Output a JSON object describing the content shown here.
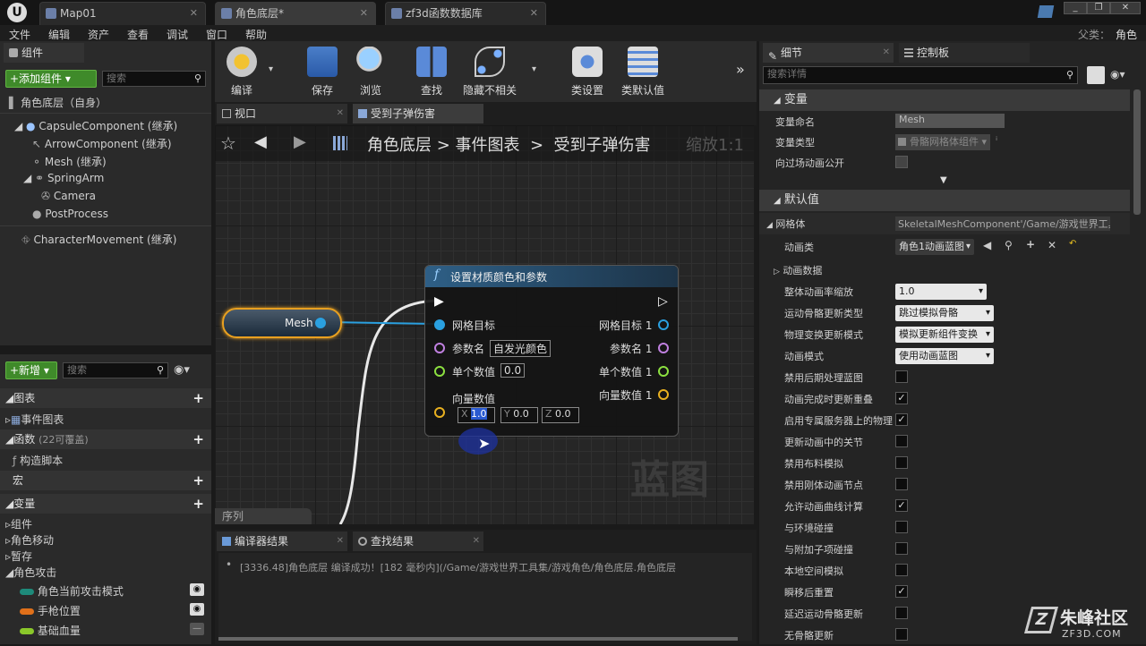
{
  "titlebar": {
    "tabs": [
      "Map01",
      "角色底层*",
      "zf3d函数数据库"
    ],
    "parent_label": "父类：",
    "parent_value": "角色"
  },
  "menu": [
    "文件",
    "编辑",
    "资产",
    "查看",
    "调试",
    "窗口",
    "帮助"
  ],
  "components": {
    "tab": "组件",
    "add_button": "+添加组件",
    "search_placeholder": "搜索",
    "root": "角色底层（自身）",
    "items": [
      "CapsuleComponent (继承)",
      "ArrowComponent (继承)",
      "Mesh (继承)",
      "SpringArm",
      "Camera",
      "PostProcess",
      "CharacterMovement (继承)"
    ]
  },
  "mybp": {
    "add_button": "+新增",
    "search_placeholder": "搜索",
    "sections": {
      "graphs": "图表",
      "event_graph": "事件图表",
      "functions": "函数",
      "functions_note": "(22可覆盖)",
      "construction": "构造脚本",
      "macros": "宏",
      "variables": "变量"
    },
    "var_groups": [
      "组件",
      "角色移动",
      "暂存",
      "角色攻击"
    ],
    "vars": [
      "角色当前攻击模式",
      "手枪位置",
      "基础血量"
    ],
    "var_colors": [
      "#1e8a7a",
      "#e0701a",
      "#8ac82a"
    ]
  },
  "toolbar": {
    "buttons": [
      "编译",
      "保存",
      "浏览",
      "查找",
      "隐藏不相关",
      "类设置",
      "类默认值"
    ]
  },
  "graph": {
    "tabs": [
      "视口",
      "受到子弹伤害"
    ],
    "breadcrumb": [
      "角色底层",
      "事件图表",
      "受到子弹伤害"
    ],
    "zoom": "缩放1:1",
    "watermark": "蓝图",
    "sequence_label": "序列",
    "mesh_node": "Mesh",
    "func_node": {
      "title": "设置材质颜色和参数",
      "in_target": "网格目标",
      "in_param_name": "参数名",
      "param_name_value": "自发光颜色",
      "in_scalar": "单个数值",
      "scalar_value": "0.0",
      "in_vector": "向量数值",
      "vec_x": "1.0",
      "vec_y": "0.0",
      "vec_z": "0.0",
      "out_target": "网格目标 1",
      "out_param": "参数名 1",
      "out_scalar": "单个数值 1",
      "out_vector": "向量数值 1"
    }
  },
  "output": {
    "tabs": [
      "编译器结果",
      "查找结果"
    ],
    "log": "[3336.48]角色底层 编译成功！[182 毫秒内](/Game/游戏世界工具集/游戏角色/角色底层.角色底层"
  },
  "details": {
    "tabs": [
      "细节",
      "控制板"
    ],
    "search_placeholder": "搜索详情",
    "variable_section": "变量",
    "var_name_label": "变量命名",
    "var_name_value": "Mesh",
    "var_type_label": "变量类型",
    "var_type_value": "骨骼网格体组件",
    "expose_label": "向过场动画公开",
    "defaults_section": "默认值",
    "mesh_label": "网格体",
    "mesh_value": "SkeletalMeshComponent'/Game/游戏世界工具",
    "anim_class_label": "动画类",
    "anim_class_value": "角色1动画蓝图",
    "anim_data_label": "动画数据",
    "rows": [
      {
        "label": "整体动画率缩放",
        "kind": "num",
        "value": "1.0"
      },
      {
        "label": "运动骨骼更新类型",
        "kind": "drop",
        "value": "跳过模拟骨骼"
      },
      {
        "label": "物理变换更新模式",
        "kind": "drop",
        "value": "模拟更新组件变换"
      },
      {
        "label": "动画模式",
        "kind": "drop",
        "value": "使用动画蓝图"
      },
      {
        "label": "禁用后期处理蓝图",
        "kind": "cb",
        "value": ""
      },
      {
        "label": "动画完成时更新重叠",
        "kind": "cb",
        "value": "✓"
      },
      {
        "label": "启用专属服务器上的物理",
        "kind": "cb",
        "value": "✓"
      },
      {
        "label": "更新动画中的关节",
        "kind": "cb",
        "value": ""
      },
      {
        "label": "禁用布料模拟",
        "kind": "cb",
        "value": ""
      },
      {
        "label": "禁用刚体动画节点",
        "kind": "cb",
        "value": ""
      },
      {
        "label": "允许动画曲线计算",
        "kind": "cb",
        "value": "✓"
      },
      {
        "label": "与环境碰撞",
        "kind": "cb",
        "value": ""
      },
      {
        "label": "与附加子项碰撞",
        "kind": "cb",
        "value": ""
      },
      {
        "label": "本地空间模拟",
        "kind": "cb",
        "value": ""
      },
      {
        "label": "瞬移后重置",
        "kind": "cb",
        "value": "✓"
      },
      {
        "label": "延迟运动骨骼更新",
        "kind": "cb",
        "value": ""
      },
      {
        "label": "无骨骼更新",
        "kind": "cb",
        "value": ""
      }
    ]
  },
  "watermark": {
    "brand": "朱峰社区",
    "url": "ZF3D.COM"
  }
}
